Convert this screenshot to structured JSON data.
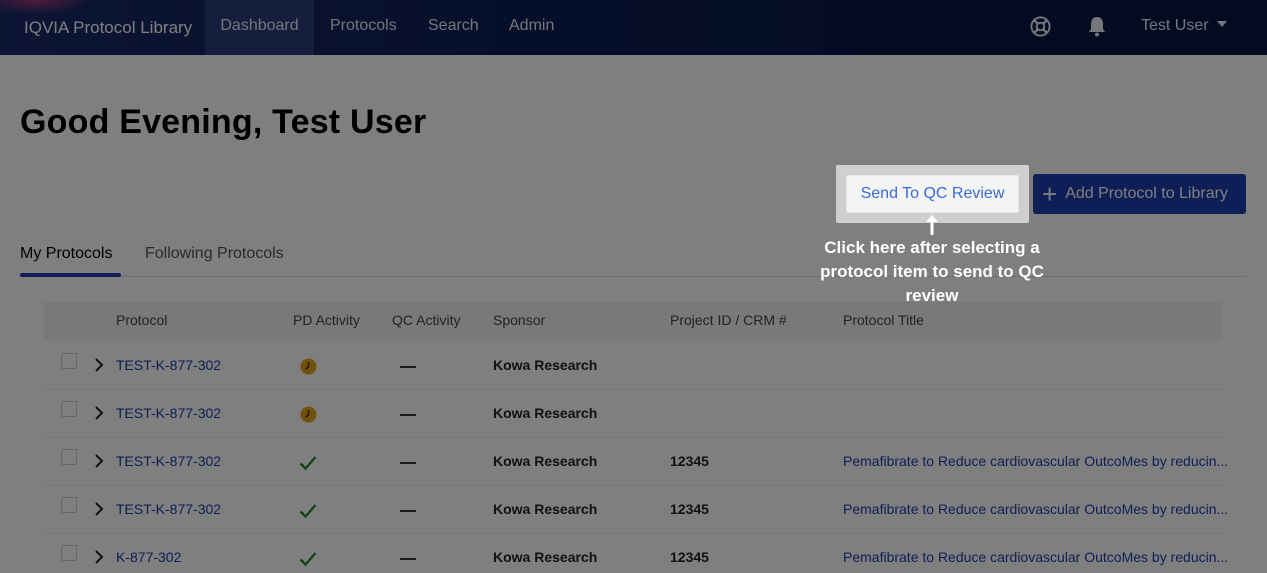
{
  "nav": {
    "brand": "IQVIA Protocol Library",
    "items": [
      "Dashboard",
      "Protocols",
      "Search",
      "Admin"
    ],
    "active": "Dashboard",
    "user": "Test User"
  },
  "greeting": "Good Evening, Test User",
  "actions": {
    "send_qc": "Send To QC Review",
    "add_protocol": "Add Protocol to Library"
  },
  "tooltip": "Click here after selecting a protocol item to send to QC review",
  "tabs": [
    "My Protocols",
    "Following Protocols"
  ],
  "table": {
    "headers": [
      "Protocol",
      "PD Activity",
      "QC Activity",
      "Sponsor",
      "Project ID / CRM #",
      "Protocol Title"
    ],
    "rows": [
      {
        "protocol": "TEST-K-877-302",
        "pd_status": "in-progress",
        "qc": "—",
        "sponsor": "Kowa Research",
        "project_id": "",
        "title": ""
      },
      {
        "protocol": "TEST-K-877-302",
        "pd_status": "in-progress",
        "qc": "—",
        "sponsor": "Kowa Research",
        "project_id": "",
        "title": ""
      },
      {
        "protocol": "TEST-K-877-302",
        "pd_status": "complete",
        "qc": "—",
        "sponsor": "Kowa Research",
        "project_id": "12345",
        "title": "Pemafibrate to Reduce cardiovascular OutcoMes by reducin..."
      },
      {
        "protocol": "TEST-K-877-302",
        "pd_status": "complete",
        "qc": "—",
        "sponsor": "Kowa Research",
        "project_id": "12345",
        "title": "Pemafibrate to Reduce cardiovascular OutcoMes by reducin..."
      },
      {
        "protocol": "K-877-302",
        "pd_status": "complete",
        "qc": "—",
        "sponsor": "Kowa Research",
        "project_id": "12345",
        "title": "Pemafibrate to Reduce cardiovascular OutcoMes by reducin..."
      }
    ]
  },
  "colors": {
    "nav_bg": "#0d1f55",
    "primary": "#1d3fae",
    "pending": "#e8a317",
    "success": "#1f8a3a"
  }
}
